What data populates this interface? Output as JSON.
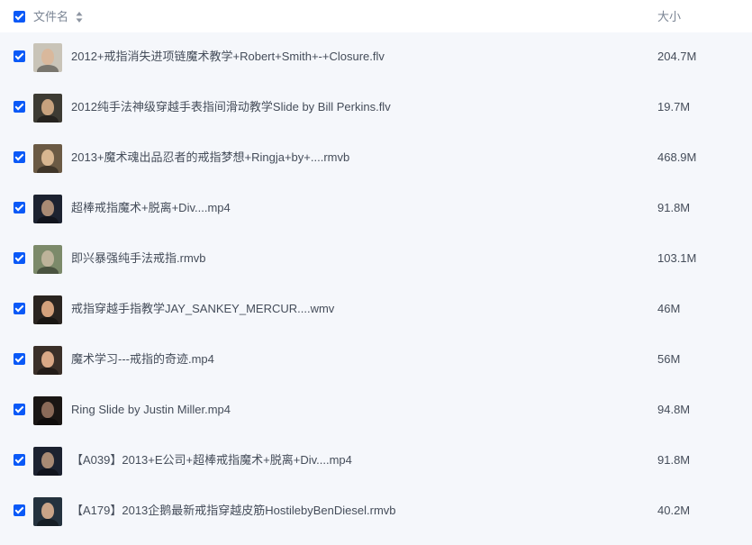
{
  "header": {
    "name_label": "文件名",
    "size_label": "大小",
    "sort_icon": "sort-updown-icon",
    "select_all_checked": true
  },
  "accent_color": "#0a59f7",
  "files": [
    {
      "name": "2012+戒指消失进项链魔术教学+Robert+Smith+-+Closure.flv",
      "size": "204.7M",
      "checked": true,
      "thumb": {
        "bg": "#c9c4b8",
        "face": "#d9b89c"
      }
    },
    {
      "name": "2012纯手法神级穿越手表指间滑动教学Slide by Bill Perkins.flv",
      "size": "19.7M",
      "checked": true,
      "thumb": {
        "bg": "#3d3b33",
        "face": "#c7a27e"
      }
    },
    {
      "name": "2013+魔术魂出品忍者的戒指梦想+Ringja+by+....rmvb",
      "size": "468.9M",
      "checked": true,
      "thumb": {
        "bg": "#6b5a44",
        "face": "#d8b690"
      }
    },
    {
      "name": "超棒戒指魔术+脱离+Div....mp4",
      "size": "91.8M",
      "checked": true,
      "thumb": {
        "bg": "#1c2230",
        "face": "#a88a74"
      }
    },
    {
      "name": "即兴暴强纯手法戒指.rmvb",
      "size": "103.1M",
      "checked": true,
      "thumb": {
        "bg": "#7c8a6a",
        "face": "#bdb39a"
      }
    },
    {
      "name": "戒指穿越手指教学JAY_SANKEY_MERCUR....wmv",
      "size": "46M",
      "checked": true,
      "thumb": {
        "bg": "#2a2420",
        "face": "#d4a17c"
      }
    },
    {
      "name": "魔术学习---戒指的奇迹.mp4",
      "size": "56M",
      "checked": true,
      "thumb": {
        "bg": "#3a2f28",
        "face": "#d9a886"
      }
    },
    {
      "name": "Ring Slide by Justin Miller.mp4",
      "size": "94.8M",
      "checked": true,
      "thumb": {
        "bg": "#1a1614",
        "face": "#8a6a58"
      }
    },
    {
      "name": "【A039】2013+E公司+超棒戒指魔术+脱离+Div....mp4",
      "size": "91.8M",
      "checked": true,
      "thumb": {
        "bg": "#1c2230",
        "face": "#a88a74"
      }
    },
    {
      "name": "【A179】2013企鹅最新戒指穿越皮筋HostilebyBenDiesel.rmvb",
      "size": "40.2M",
      "checked": true,
      "thumb": {
        "bg": "#24323e",
        "face": "#c9a488"
      }
    }
  ]
}
